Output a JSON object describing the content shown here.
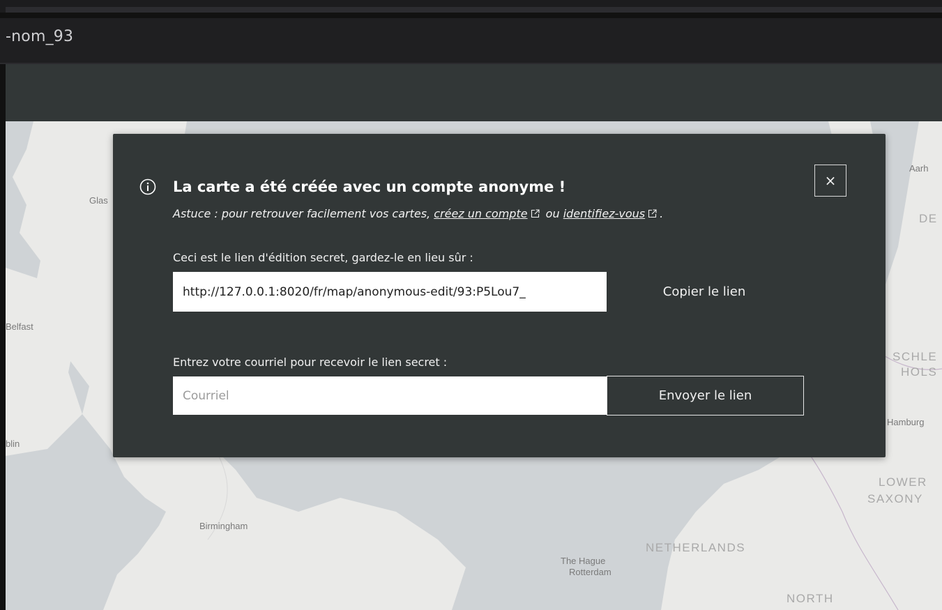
{
  "window": {
    "title": "-nom_93"
  },
  "map": {
    "labels": {
      "glasgow": "Glas",
      "belfast": "Belfast",
      "dublin": "blin",
      "birmingham": "Birmingham",
      "the_hague": "The Hague",
      "rotterdam": "Rotterdam",
      "netherlands": "NETHERLANDS",
      "north": "NORTH",
      "aarhus": "Aarh",
      "de": "DE",
      "schleswig_line1": "SCHLE",
      "schleswig_line2": "HOLS",
      "hamburg": "Hamburg",
      "lower_saxony_line1": "LOWER",
      "lower_saxony_line2": "SAXONY"
    }
  },
  "modal": {
    "title": "La carte a été créée avec un compte anonyme !",
    "tip_prefix": "Astuce : pour retrouver facilement vos cartes,",
    "create_account_link": "créez un compte",
    "or_text": "ou",
    "login_link": "identifiez-vous",
    "tip_suffix": ".",
    "close_symbol": "×",
    "secret_link_label": "Ceci est le lien d'édition secret, gardez-le en lieu sûr :",
    "secret_link_value": "http://127.0.0.1:8020/fr/map/anonymous-edit/93:P5Lou7_",
    "copy_button": "Copier le lien",
    "email_label": "Entrez votre courriel pour recevoir le lien secret :",
    "email_placeholder": "Courriel",
    "send_button": "Envoyer le lien"
  }
}
